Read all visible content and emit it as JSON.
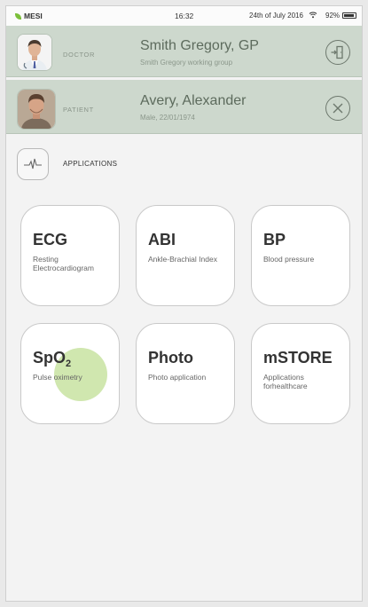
{
  "status_bar": {
    "app_name": "MESI",
    "time": "16:32",
    "date": "24th of July 2016",
    "battery": "92%",
    "battery_level": 0.92
  },
  "doctor": {
    "role": "DOCTOR",
    "name": "Smith Gregory, GP",
    "subtitle": "Smith Gregory working group",
    "action_icon": "logout-door-icon"
  },
  "patient": {
    "role": "PATIENT",
    "name": "Avery, Alexander",
    "subtitle": "Male, 22/01/1974",
    "action_icon": "close-icon"
  },
  "applications": {
    "title": "APPLICATIONS",
    "icon": "ecg-waveform-icon",
    "tiles": [
      {
        "title": "ECG",
        "desc": "Resting Electrocardiogram"
      },
      {
        "title": "ABI",
        "desc": "Ankle-Brachial Index"
      },
      {
        "title": "BP",
        "desc": "Blood pressure"
      },
      {
        "title_main": "SpO",
        "title_sub": "2",
        "desc": "Pulse oximetry"
      },
      {
        "title": "Photo",
        "desc": "Photo application"
      },
      {
        "title": "mSTORE",
        "desc": "Applications forhealthcare"
      }
    ]
  },
  "colors": {
    "header_rows": "#cdd8cd",
    "accent_green": "#7bbf3a",
    "ripple": "#aad46e"
  }
}
